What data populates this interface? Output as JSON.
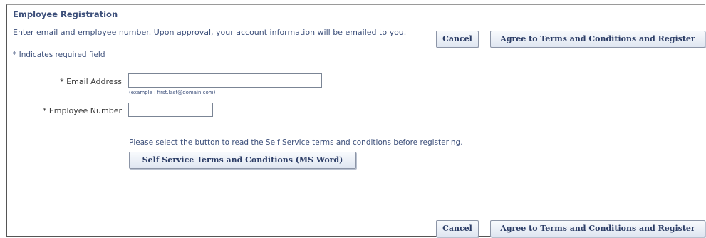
{
  "form": {
    "title": "Employee Registration",
    "instructions": "Enter email and employee number. Upon approval, your account information will be emailed to you.",
    "required_star": "*",
    "required_note": "Indicates required field",
    "email": {
      "label": "* Email Address",
      "value": "",
      "example": "(example : first.last@domain.com)"
    },
    "employee_number": {
      "label": "* Employee Number",
      "value": ""
    },
    "terms_instructions": "Please select the button to read the Self Service terms and conditions before registering.",
    "terms_button_label": "Self Service Terms and Conditions (MS Word)"
  },
  "actions": {
    "cancel_label": "Cancel",
    "register_label": "Agree to Terms and Conditions and Register"
  },
  "colors": {
    "header_text": "#3c4f7a",
    "button_text": "#2c3d66",
    "button_border": "#8c95a7"
  }
}
